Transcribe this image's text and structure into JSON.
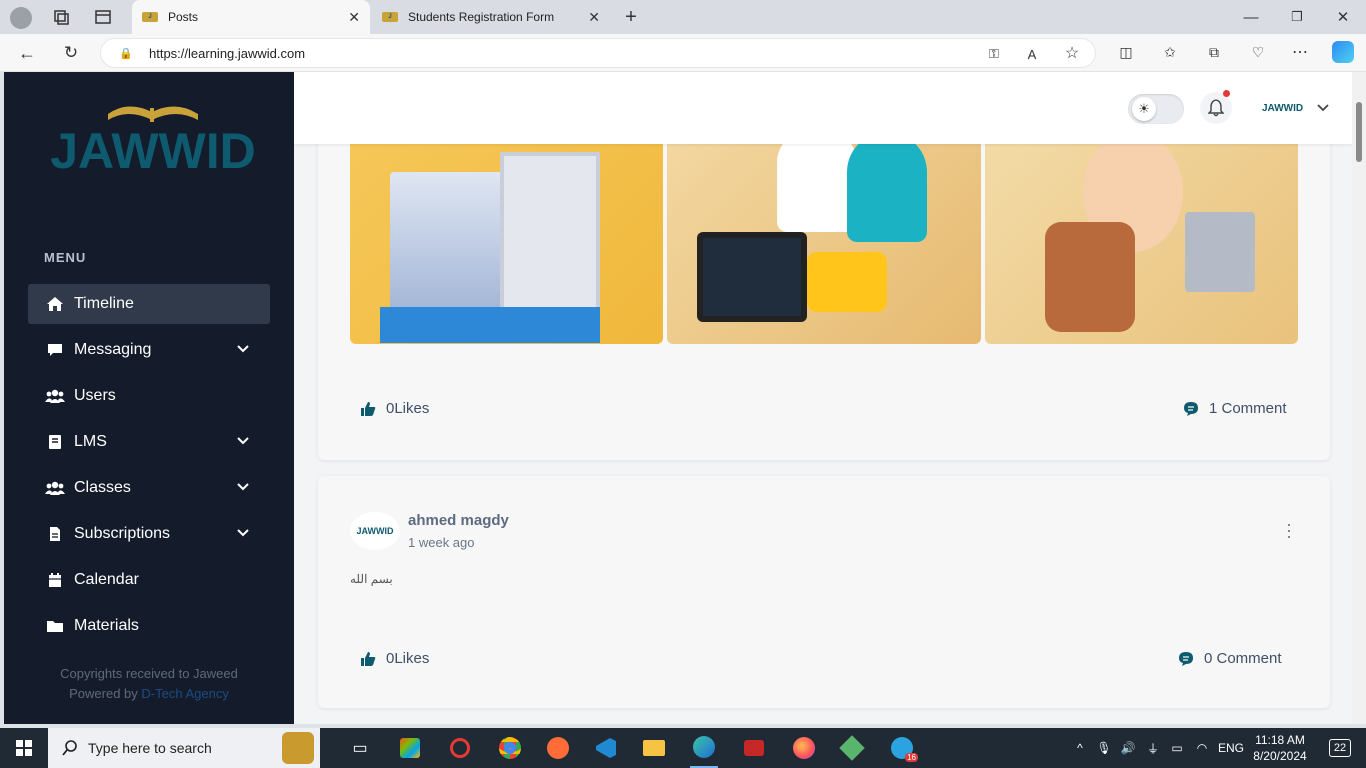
{
  "browser": {
    "tabs": [
      {
        "title": "Posts"
      },
      {
        "title": "Students Registration Form"
      }
    ],
    "url": "https://learning.jawwid.com"
  },
  "sidebar": {
    "logo_text": "JAWWID",
    "menu_heading": "MENU",
    "items": [
      {
        "label": "Timeline",
        "icon": "home-icon",
        "active": true
      },
      {
        "label": "Messaging",
        "icon": "chat-icon",
        "chevron": true
      },
      {
        "label": "Users",
        "icon": "users-icon"
      },
      {
        "label": "LMS",
        "icon": "book-icon",
        "chevron": true
      },
      {
        "label": "Classes",
        "icon": "users-icon",
        "chevron": true
      },
      {
        "label": "Subscriptions",
        "icon": "document-icon",
        "chevron": true
      },
      {
        "label": "Calendar",
        "icon": "calendar-icon"
      },
      {
        "label": "Materials",
        "icon": "folder-icon"
      }
    ],
    "copyright": "Copyrights received to Jaweed",
    "powered_by": "Powered by",
    "agency": "D-Tech Agency"
  },
  "header": {
    "profile_logo": "JAWWID"
  },
  "posts": [
    {
      "likes": "0Likes",
      "comments": "1 Comment"
    },
    {
      "author": "ahmed magdy",
      "time": "1 week ago",
      "body": "بسم الله",
      "likes": "0Likes",
      "comments": "0 Comment"
    }
  ],
  "taskbar": {
    "search_placeholder": "Type here to search",
    "time": "11:18 AM",
    "date": "8/20/2024",
    "lang": "ENG",
    "notifications": "22",
    "telegram_badge": "16"
  },
  "colors": {
    "sidebar": "#141c2c",
    "accent": "#0e5b6f",
    "gold": "#c9a23a"
  }
}
